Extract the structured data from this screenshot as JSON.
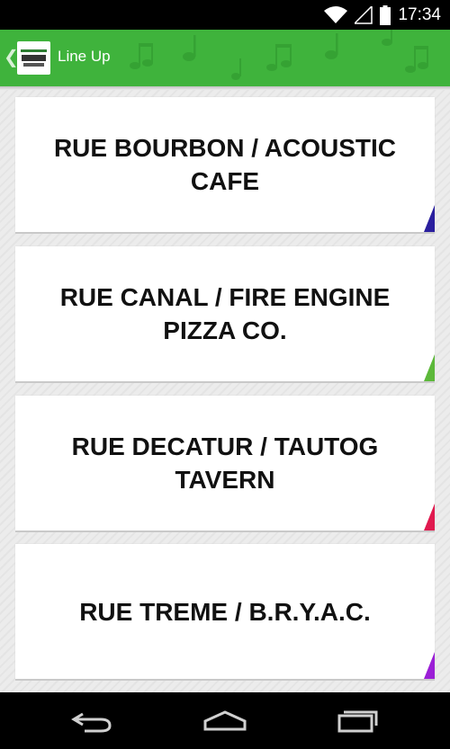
{
  "status_bar": {
    "time": "17:34"
  },
  "action_bar": {
    "title": "Line Up",
    "logo_icon": "app-logo-icon",
    "background": "#3fb33c"
  },
  "cards": [
    {
      "label": "RUE BOURBON / ACOUSTIC CAFE",
      "accent": "#2a1f9e"
    },
    {
      "label": "RUE CANAL / FIRE ENGINE PIZZA CO.",
      "accent": "#5cb83a"
    },
    {
      "label": "RUE DECATUR / TAUTOG TAVERN",
      "accent": "#e01a4f"
    },
    {
      "label": "RUE TREME / B.R.Y.A.C.",
      "accent": "#9b1fd6"
    }
  ],
  "nav_bar": {
    "icons": [
      "back-icon",
      "home-icon",
      "recent-apps-icon"
    ]
  }
}
